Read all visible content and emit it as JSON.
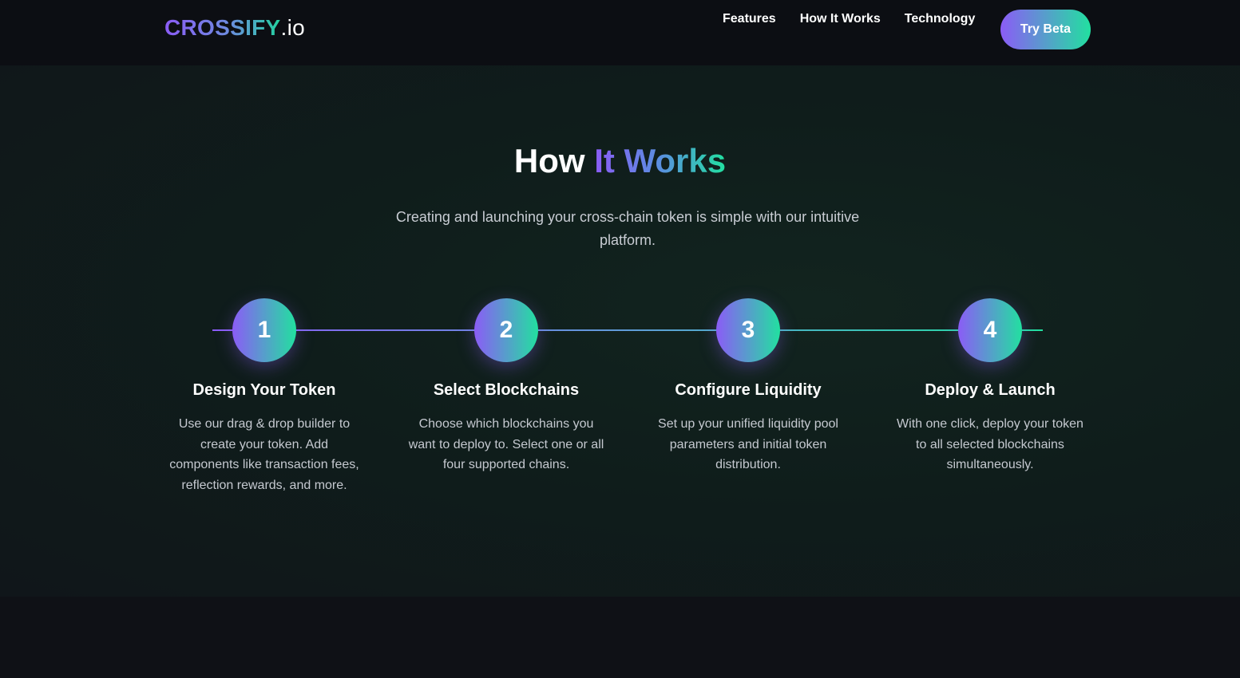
{
  "nav": {
    "logo_main": "CROSSIFY",
    "logo_ext": ".io",
    "links": [
      "Features",
      "How It Works",
      "Technology"
    ],
    "cta_label": "Try Beta"
  },
  "section": {
    "title_plain": "How",
    "title_highlight_1": "It",
    "title_highlight_2": "Works",
    "subtitle": "Creating and launching your cross-chain token is simple with our intuitive platform.",
    "steps": [
      {
        "number": "1",
        "title": "Design Your Token",
        "description": "Use our drag & drop builder to create your token. Add components like transaction fees, reflection rewards, and more."
      },
      {
        "number": "2",
        "title": "Select Blockchains",
        "description": "Choose which blockchains you want to deploy to. Select one or all four supported chains."
      },
      {
        "number": "3",
        "title": "Configure Liquidity",
        "description": "Set up your unified liquidity pool parameters and initial token distribution."
      },
      {
        "number": "4",
        "title": "Deploy & Launch",
        "description": "With one click, deploy your token to all selected blockchains simultaneously."
      }
    ]
  },
  "colors": {
    "background": "#0f1116",
    "navbar": "#0c0e13",
    "gradient_start": "#8b5cf6",
    "gradient_end": "#22e0a0",
    "text_muted": "#c5c9d0"
  }
}
